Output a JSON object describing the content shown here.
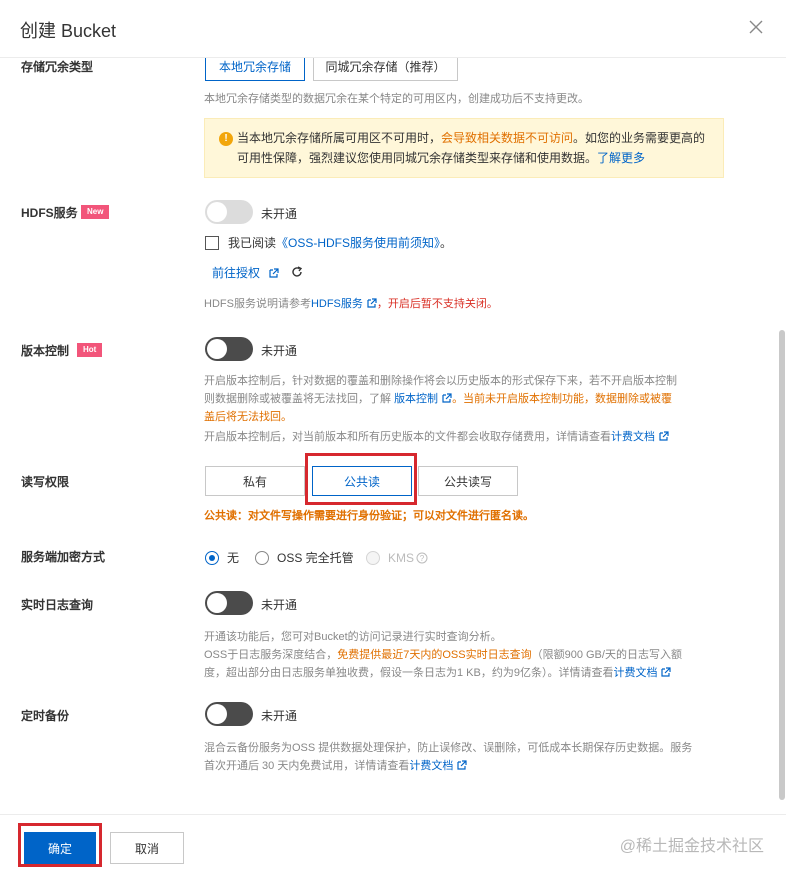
{
  "dialog": {
    "title": "创建 Bucket",
    "close_icon": "close-icon"
  },
  "redundancy": {
    "label": "存储冗余类型",
    "options": [
      "本地冗余存储",
      "同城冗余存储（推荐）"
    ],
    "selected": "本地冗余存储",
    "hint": "本地冗余存储类型的数据冗余在某个特定的可用区内，创建成功后不支持更改。",
    "alert": {
      "icon": "warning-icon",
      "text_prefix": "当本地冗余存储所属可用区不可用时，",
      "text_warn": "会导致相关数据不可访问",
      "text_mid": "。如您的业务需要更高的可用性保障，强烈建议您使用同城冗余存储类型来存储和使用数据。",
      "link": "了解更多"
    }
  },
  "hdfs": {
    "label": "HDFS服务",
    "badge": "New",
    "toggle_text": "未开通",
    "checkbox_prefix": "我已阅读",
    "checkbox_link": "《OSS-HDFS服务使用前须知》",
    "checkbox_suffix": "。",
    "auth_link": "前往授权",
    "hint_prefix": "HDFS服务说明请参考",
    "hint_link": "HDFS服务",
    "hint_danger": "，开启后暂不支持关闭。"
  },
  "versioning": {
    "label": "版本控制",
    "badge": "Hot",
    "toggle_text": "未开通",
    "hint_line1": "开启版本控制后，针对数据的覆盖和删除操作将会以历史版本的形式保存下来，若不开启版本控制",
    "hint_line2_prefix": "则数据删除或被覆盖将无法找回，了解 ",
    "hint_line2_link": "版本控制",
    "hint_line2_warn": "。当前未开启版本控制功能，数据删除或被覆",
    "hint_line3_warn": "盖后将无法找回。",
    "hint_line4_prefix": "开启版本控制后，对当前版本和所有历史版本的文件都会收取存储费用，详情请查看",
    "hint_line4_link": "计费文档"
  },
  "acl": {
    "label": "读写权限",
    "options": [
      "私有",
      "公共读",
      "公共读写"
    ],
    "selected": "公共读",
    "warning": "公共读：对文件写操作需要进行身份验证；可以对文件进行匿名读。"
  },
  "encryption": {
    "label": "服务端加密方式",
    "options": [
      "无",
      "OSS 完全托管",
      "KMS"
    ],
    "selected": "无",
    "help_icon": "help-icon"
  },
  "realtime_log": {
    "label": "实时日志查询",
    "toggle_text": "未开通",
    "hint_line1": "开通该功能后，您可对Bucket的访问记录进行实时查询分析。",
    "hint_line2_prefix": "OSS于日志服务深度结合，",
    "hint_line2_warn": "免费提供最近7天内的OSS实时日志查询",
    "hint_line2_suffix": "（限额900 GB/天的日志写入额",
    "hint_line3_prefix": "度，超出部分由日志服务单独收费，假设一条日志为1 KB，约为9亿条）。详情请查看",
    "hint_line3_link": "计费文档"
  },
  "backup": {
    "label": "定时备份",
    "toggle_text": "未开通",
    "hint_line1": "混合云备份服务为OSS 提供数据处理保护，防止误修改、误删除，可低成本长期保存历史数据。服务",
    "hint_line2_prefix": "首次开通后 30 天内免费试用，详情请查看",
    "hint_line2_link": "计费文档"
  },
  "footer": {
    "confirm": "确定",
    "cancel": "取消",
    "watermark": "@稀土掘金技术社区"
  },
  "colors": {
    "primary": "#0064c8",
    "warning": "#e07000",
    "danger": "#d93026",
    "highlight_box": "#d6282e"
  }
}
